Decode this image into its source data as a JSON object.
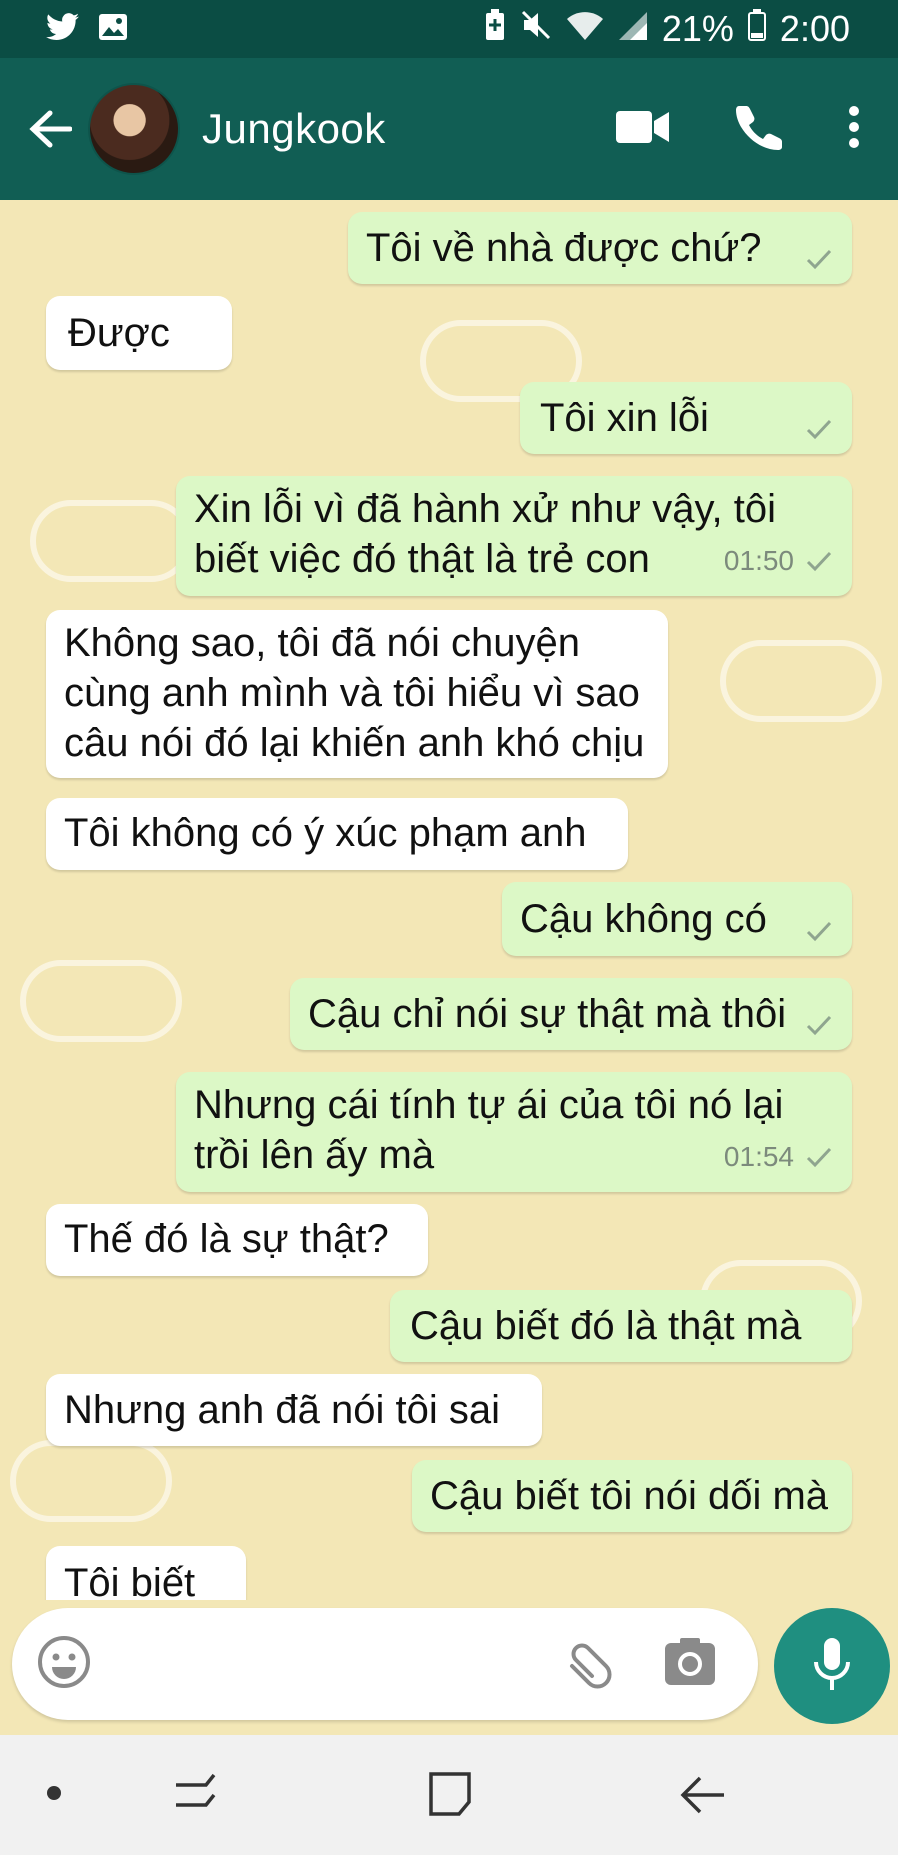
{
  "status_bar": {
    "battery_percent": "21%",
    "time": "2:00"
  },
  "header": {
    "contact_name": "Jungkook"
  },
  "messages": [
    {
      "direction": "out",
      "lines": [
        "Tôi về nhà được chứ?"
      ],
      "time": ""
    },
    {
      "direction": "in",
      "lines": [
        "Được"
      ],
      "time": ""
    },
    {
      "direction": "out",
      "lines": [
        "Tôi xin lỗi"
      ],
      "time": ""
    },
    {
      "direction": "out",
      "lines": [
        "Xin lỗi vì đã hành xử như vậy, tôi",
        "biết việc đó thật là trẻ con"
      ],
      "time": "01:50"
    },
    {
      "direction": "in",
      "lines": [
        "Không sao, tôi đã nói chuyện",
        "cùng anh mình và tôi hiểu vì sao",
        "câu nói đó lại khiến anh khó chịu"
      ],
      "time": ""
    },
    {
      "direction": "in",
      "lines": [
        "Tôi không có ý xúc phạm anh"
      ],
      "time": ""
    },
    {
      "direction": "out",
      "lines": [
        "Cậu không có"
      ],
      "time": ""
    },
    {
      "direction": "out",
      "lines": [
        "Cậu chỉ nói sự thật mà thôi"
      ],
      "time": ""
    },
    {
      "direction": "out",
      "lines": [
        "Nhưng cái tính tự ái của tôi nó lại",
        "trồi lên ấy mà"
      ],
      "time": "01:54"
    },
    {
      "direction": "in",
      "lines": [
        "Thế đó là sự thật?"
      ],
      "time": ""
    },
    {
      "direction": "out",
      "lines": [
        "Cậu biết đó là thật mà"
      ],
      "time": ""
    },
    {
      "direction": "in",
      "lines": [
        "Nhưng anh đã nói tôi sai"
      ],
      "time": ""
    },
    {
      "direction": "out",
      "lines": [
        "Cậu biết tôi nói dối mà"
      ],
      "time": ""
    },
    {
      "direction": "in",
      "lines": [
        "Tôi biết"
      ],
      "time": ""
    }
  ],
  "icons": {
    "status_left": [
      "twitter-icon",
      "gallery-icon"
    ],
    "status_right": [
      "battery-saver-icon",
      "mute-icon",
      "wifi-icon",
      "signal-icon",
      "battery-icon"
    ],
    "header": [
      "back-arrow-icon",
      "video-call-icon",
      "phone-icon",
      "more-vert-icon"
    ],
    "input": [
      "emoji-icon",
      "attach-icon",
      "camera-icon",
      "mic-icon"
    ],
    "nav": [
      "dot-icon",
      "recent-apps-icon",
      "home-icon",
      "back-icon"
    ]
  },
  "colors": {
    "header": "#115e54",
    "status": "#0b4d44",
    "bubble_out": "#dcf8c6",
    "bubble_in": "#ffffff",
    "mic": "#1f8f80",
    "wallpaper": "#f3e7b6"
  }
}
